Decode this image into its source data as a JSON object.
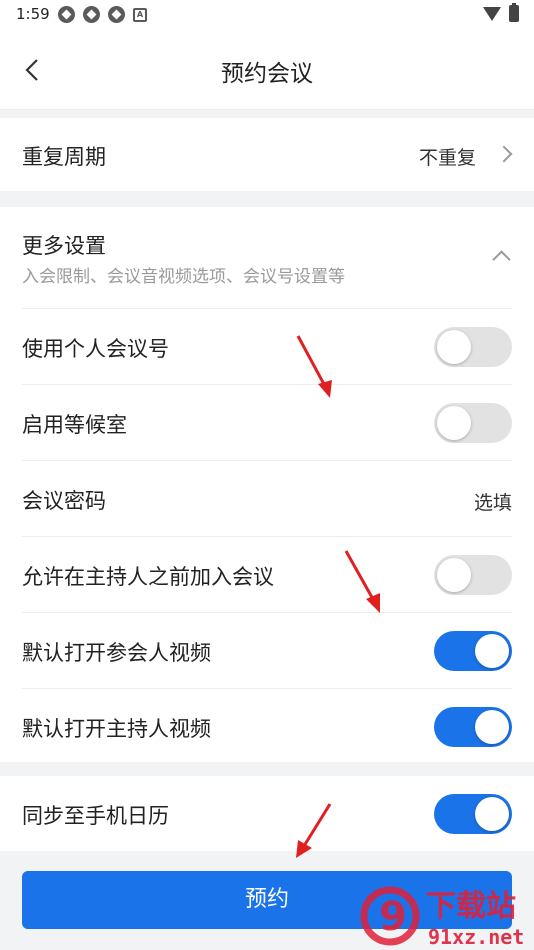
{
  "status_bar": {
    "time": "1:59",
    "icons": [
      "app-icon",
      "app-icon",
      "app-icon",
      "a-badge-icon"
    ],
    "right_icons": [
      "wifi-icon",
      "battery-icon"
    ],
    "a_label": "A"
  },
  "header": {
    "title": "预约会议",
    "back_icon": "chevron-left-icon"
  },
  "repeat": {
    "label": "重复周期",
    "value": "不重复"
  },
  "more_settings": {
    "title": "更多设置",
    "subtitle": "入会限制、会议音视频选项、会议号设置等",
    "expanded": true
  },
  "settings": [
    {
      "label": "使用个人会议号",
      "type": "toggle",
      "on": false
    },
    {
      "label": "启用等候室",
      "type": "toggle",
      "on": false
    },
    {
      "label": "会议密码",
      "type": "value",
      "value": "选填"
    },
    {
      "label": "允许在主持人之前加入会议",
      "type": "toggle",
      "on": false
    },
    {
      "label": "默认打开参会人视频",
      "type": "toggle",
      "on": true
    },
    {
      "label": "默认打开主持人视频",
      "type": "toggle",
      "on": true
    }
  ],
  "calendar": {
    "label": "同步至手机日历",
    "on": true
  },
  "submit_label": "预约",
  "watermark": {
    "brand": "下载站",
    "site": "91xz.net",
    "logo_text": "9"
  },
  "colors": {
    "accent": "#1a73e8",
    "toggle_off": "#e2e2e2",
    "annotation_arrow": "#e02020",
    "watermark": "#e0203a"
  }
}
